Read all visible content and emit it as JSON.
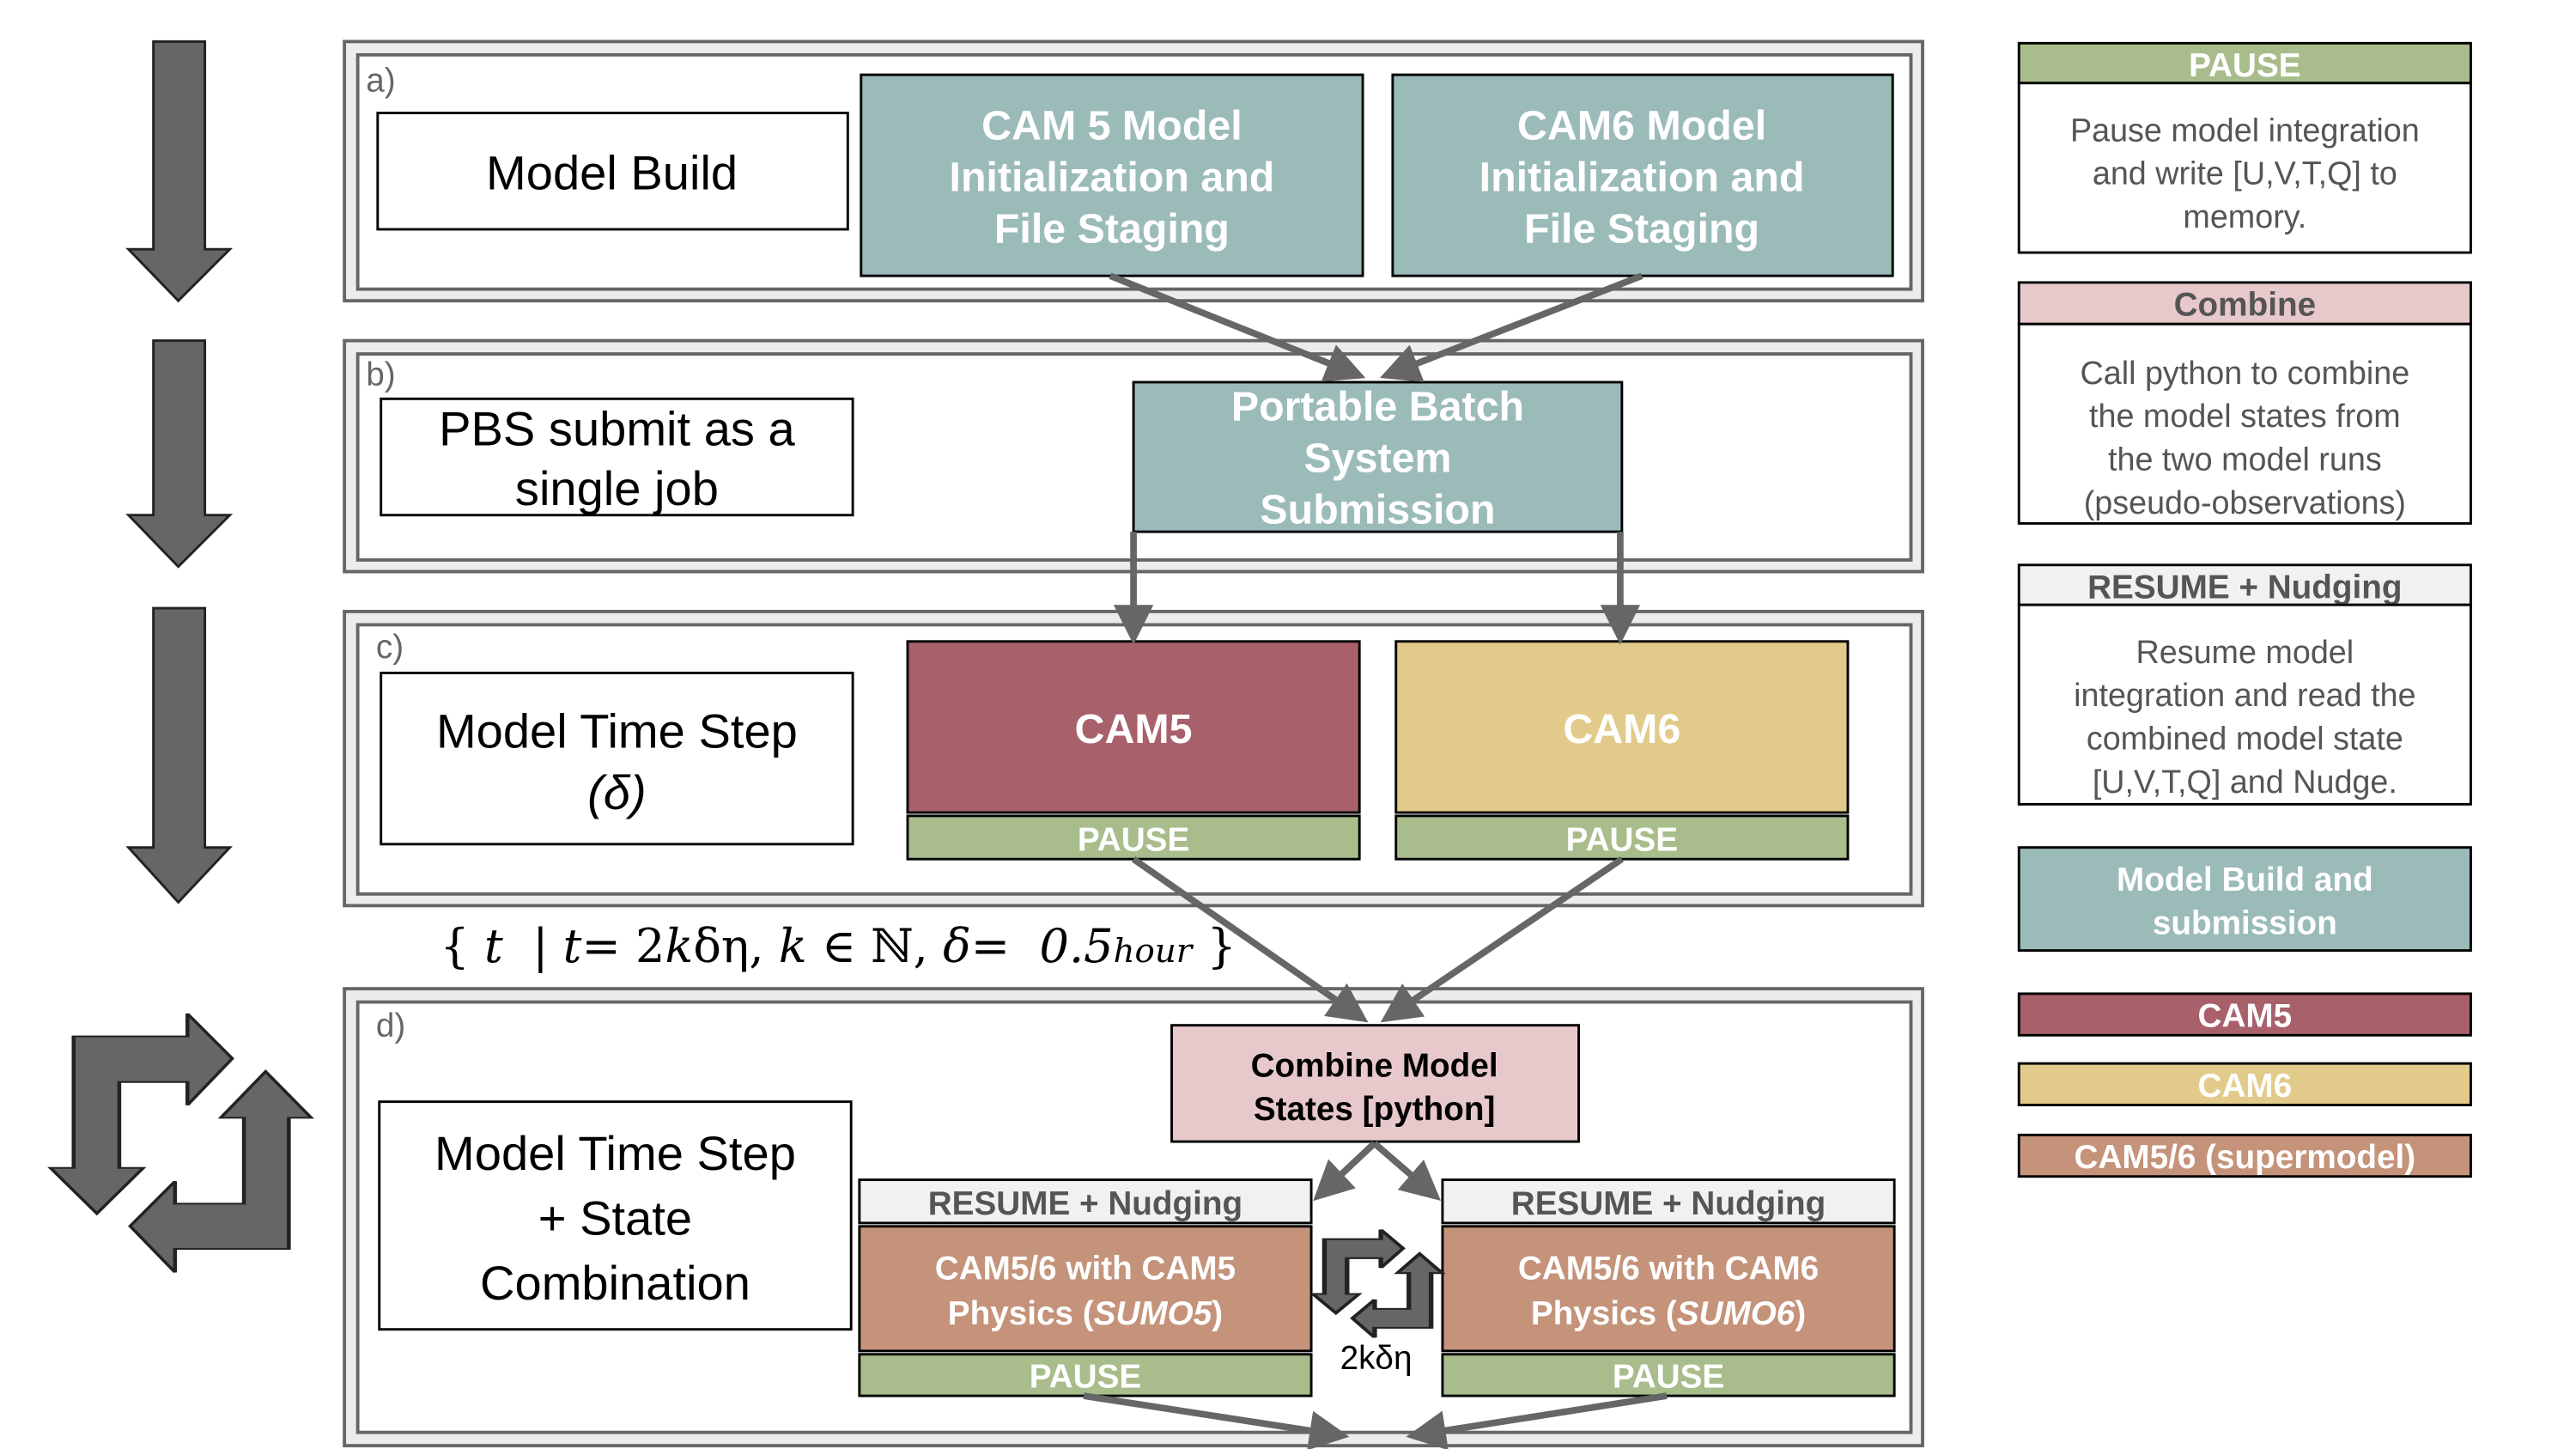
{
  "panels": {
    "a": {
      "label": "a)",
      "step": "Model Build",
      "cam5_init": [
        "CAM 5 Model",
        "Initialization and",
        "File Staging"
      ],
      "cam6_init": [
        "CAM6 Model",
        "Initialization and",
        "File Staging"
      ]
    },
    "b": {
      "label": "b)",
      "step": [
        "PBS submit as a",
        "single job"
      ],
      "pbs": [
        "Portable Batch",
        "System",
        "Submission"
      ]
    },
    "c": {
      "label": "c)",
      "step": [
        "Model Time Step",
        "(δ)"
      ],
      "cam5": "CAM5",
      "cam6": "CAM6",
      "pause": "PAUSE"
    },
    "formula": [
      "{ ",
      "t",
      "  | ",
      "t",
      "= 2",
      "k",
      "δη, ",
      "k",
      " ∈ ℕ, ",
      "δ",
      "=  0.5",
      "hour",
      " }"
    ],
    "d": {
      "label": "d)",
      "step": [
        "Model Time Step",
        "+ State",
        "Combination"
      ],
      "combine": [
        "Combine Model",
        "States [python]"
      ],
      "resume": "RESUME + Nudging",
      "sumo5": {
        "line1": "CAM5/6 with CAM5",
        "line2_pre": "Physics (",
        "line2_em": "SUMO5",
        "line2_post": ")"
      },
      "sumo6": {
        "line1": "CAM5/6 with CAM6",
        "line2_pre": "Physics (",
        "line2_em": "SUMO6",
        "line2_post": ")"
      },
      "pause": "PAUSE",
      "coupling": "2kδη"
    }
  },
  "legend": {
    "pause": {
      "title": "PAUSE",
      "text": [
        "Pause model integration",
        "and write [U,V,T,Q] to",
        "memory."
      ]
    },
    "combine": {
      "title": "Combine",
      "text": [
        "Call python to combine",
        "the model states from",
        "the two model runs",
        "(pseudo-observations)"
      ]
    },
    "resume": {
      "title": "RESUME + Nudging",
      "text": [
        "Resume model",
        "integration and read the",
        "combined model state",
        "[U,V,T,Q] and Nudge."
      ]
    },
    "build": [
      "Model Build and",
      "submission"
    ],
    "cam5": "CAM5",
    "cam6": "CAM6",
    "supermodel": "CAM5/6 (supermodel)"
  },
  "colors": {
    "teal": "#9bbbb9",
    "cam5": "#a8606a",
    "cam6": "#e2ca8a",
    "pause": "#a8bd8b",
    "combine": "#e8c9cb",
    "resume": "#f1f1f1",
    "supermodel": "#c4937a",
    "arrow": "#666666"
  }
}
